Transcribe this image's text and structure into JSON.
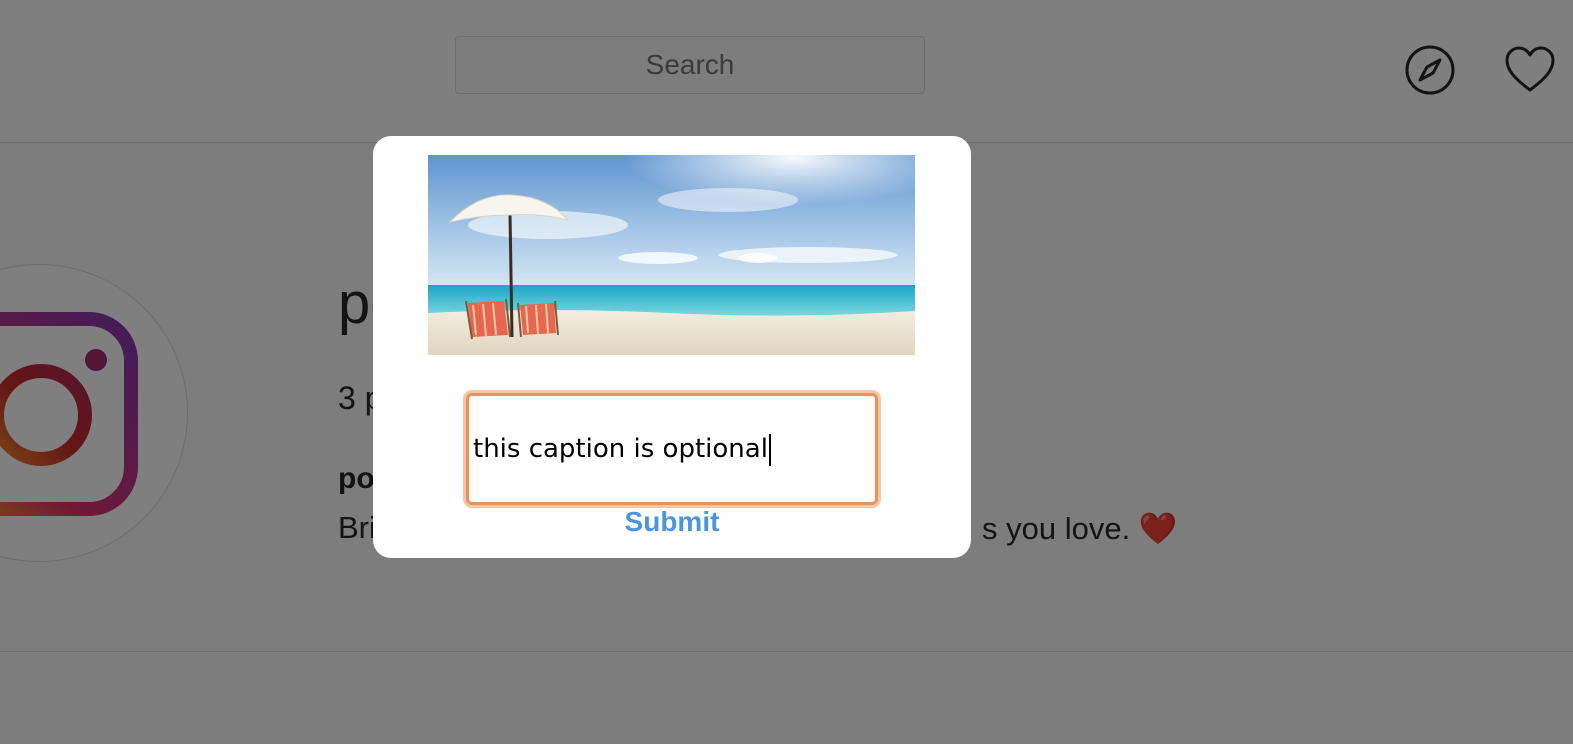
{
  "header": {
    "search_placeholder": "Search",
    "icons": [
      "compass-icon",
      "heart-icon"
    ]
  },
  "profile": {
    "username_visible": "po",
    "posts_visible": "3 p",
    "bio_name_visible": "po",
    "bio_text_left": "Bri",
    "bio_text_right": "s you love. ❤️"
  },
  "modal": {
    "image_description": "beach-photo",
    "caption_value": "this caption is optional",
    "submit_label": "Submit"
  },
  "colors": {
    "accent": "#4a95e0",
    "focus_border": "#e8925c",
    "overlay": "rgba(0,0,0,0.5)"
  }
}
